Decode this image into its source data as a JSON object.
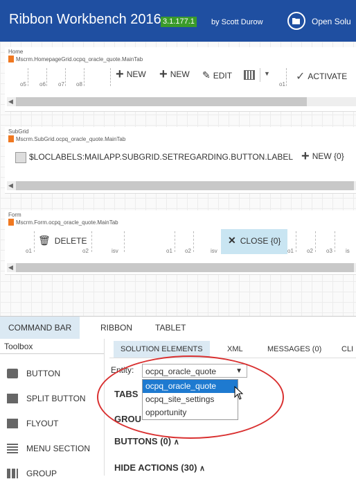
{
  "app": {
    "title": "Ribbon Workbench 2016",
    "version": "3.1.177.1",
    "author": "by Scott Durow",
    "open_solution_label": "Open Solu",
    "brand_color": "#1f4fa1",
    "badge_color": "#3a9b2a"
  },
  "panels": {
    "home": {
      "title": "Home",
      "id": "Mscrm.HomepageGrid.ocpq_oracle_quote.MainTab",
      "groups": [
        "o5",
        "o6",
        "o7",
        "o8",
        "o1"
      ],
      "buttons": [
        "NEW",
        "NEW",
        "EDIT",
        "ACTIVATE"
      ]
    },
    "subgrid": {
      "title": "SubGrid",
      "id": "Mscrm.SubGrid.ocpq_oracle_quote.MainTab",
      "buttons": [
        "$LOCLABELS:MAILAPP.SUBGRID.SETREGARDING.BUTTON.LABEL",
        "NEW {0}"
      ]
    },
    "form": {
      "title": "Form",
      "id": "Mscrm.Form.ocpq_oracle_quote.MainTab",
      "groups": [
        "o1",
        "o2",
        "isv",
        "o1",
        "o2",
        "isv",
        "o1",
        "o2",
        "o3",
        "is"
      ],
      "buttons": [
        "DELETE",
        "CLOSE {0}"
      ]
    }
  },
  "main_tabs": [
    "COMMAND BAR",
    "RIBBON",
    "TABLET"
  ],
  "toolbox": {
    "header": "Toolbox",
    "items": [
      "BUTTON",
      "SPLIT BUTTON",
      "FLYOUT",
      "MENU SECTION",
      "GROUP"
    ]
  },
  "sub_tabs": [
    "SOLUTION ELEMENTS",
    "XML",
    "MESSAGES (0)",
    "CLI"
  ],
  "entity": {
    "label": "Entity:",
    "selected": "ocpq_oracle_quote",
    "options": [
      "ocpq_oracle_quote",
      "ocpq_site_settings",
      "opportunity"
    ]
  },
  "sections": {
    "tabs": "TABS",
    "groups": "GROU",
    "buttons": "BUTTONS (0)",
    "hide_actions": "HIDE ACTIONS (30)"
  },
  "highlight_color": "#d93030"
}
